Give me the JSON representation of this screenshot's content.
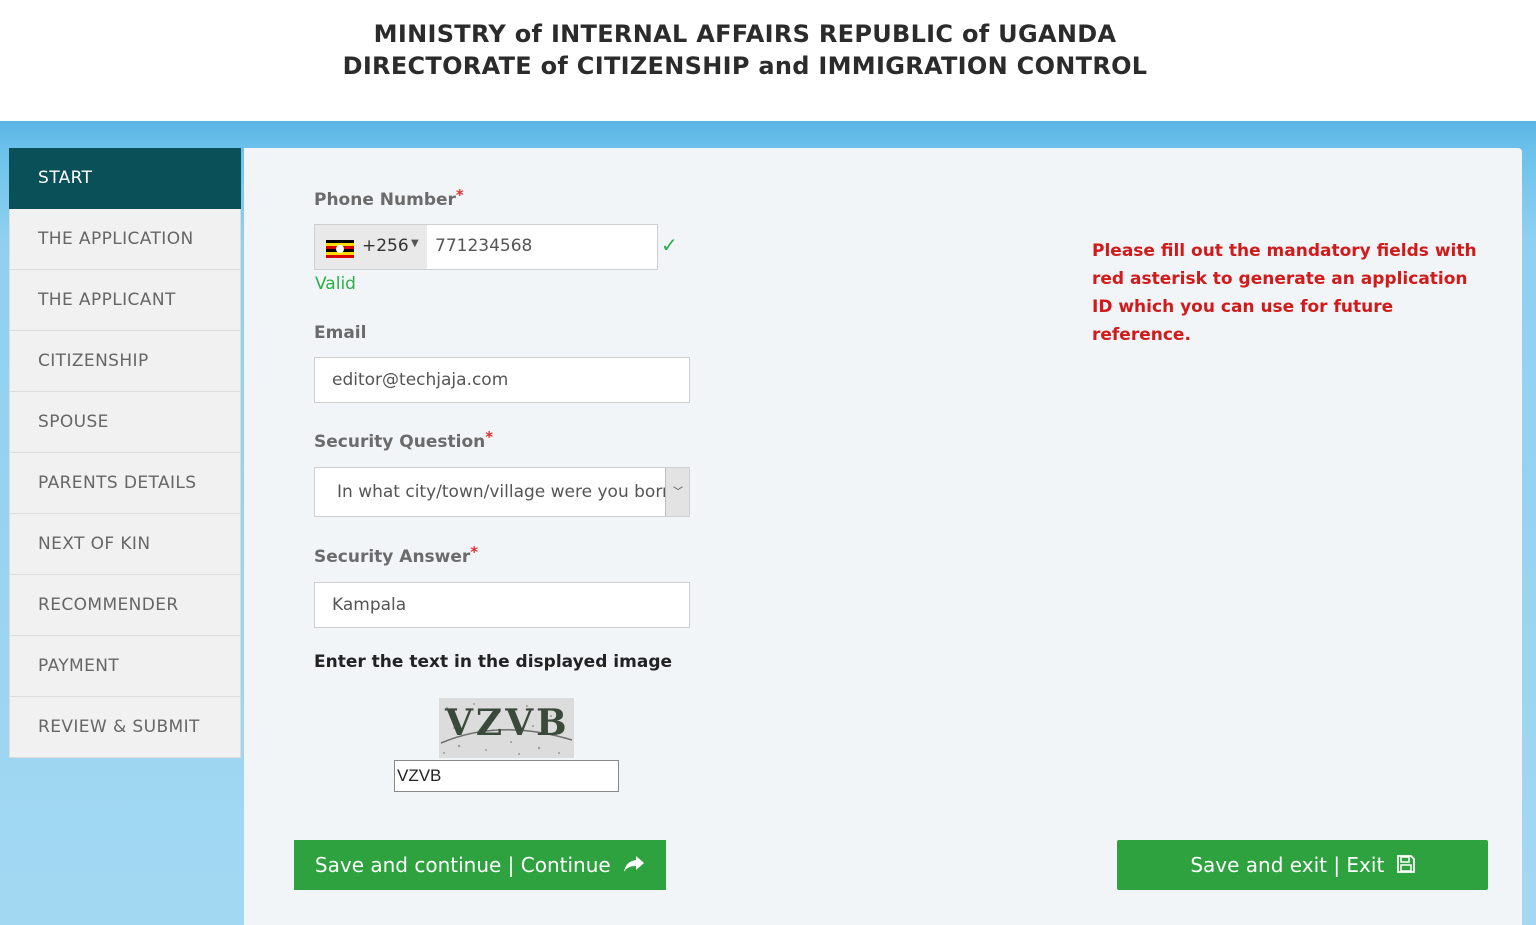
{
  "header": {
    "line1": "MINISTRY of INTERNAL AFFAIRS REPUBLIC of UGANDA",
    "line2": "DIRECTORATE of CITIZENSHIP and IMMIGRATION CONTROL"
  },
  "sidebar": {
    "items": [
      {
        "label": "START"
      },
      {
        "label": "THE APPLICATION"
      },
      {
        "label": "THE APPLICANT"
      },
      {
        "label": "CITIZENSHIP"
      },
      {
        "label": "SPOUSE"
      },
      {
        "label": "PARENTS DETAILS"
      },
      {
        "label": "NEXT OF KIN"
      },
      {
        "label": "RECOMMENDER"
      },
      {
        "label": "PAYMENT"
      },
      {
        "label": "REVIEW & SUBMIT"
      }
    ]
  },
  "form": {
    "phone": {
      "label": "Phone Number",
      "required_mark": "*",
      "country_code": "+256",
      "value": "771234568",
      "validity": "Valid"
    },
    "email": {
      "label": "Email",
      "value": "editor@techjaja.com"
    },
    "security_question": {
      "label": "Security Question",
      "required_mark": "*",
      "selected": "In what city/town/village were you born?"
    },
    "security_answer": {
      "label": "Security Answer",
      "required_mark": "*",
      "value": "Kampala"
    },
    "captcha": {
      "label": "Enter the text in the displayed image",
      "image_text": "VZVB",
      "value": "VZVB"
    }
  },
  "notice": "Please fill out the mandatory fields with red asterisk to generate an application ID which you can use for future reference.",
  "buttons": {
    "continue_label": "Save and continue | Continue",
    "exit_label": "Save and exit | Exit"
  },
  "icons": {
    "continue": "share-arrow-icon",
    "exit": "floppy-disk-icon",
    "check": "check-icon",
    "dropdown": "chevron-down-icon"
  },
  "colors": {
    "active_nav": "#0a5058",
    "button": "#2ea23f",
    "required": "#e03030",
    "notice": "#d11a1a",
    "valid": "#2eae4a"
  }
}
